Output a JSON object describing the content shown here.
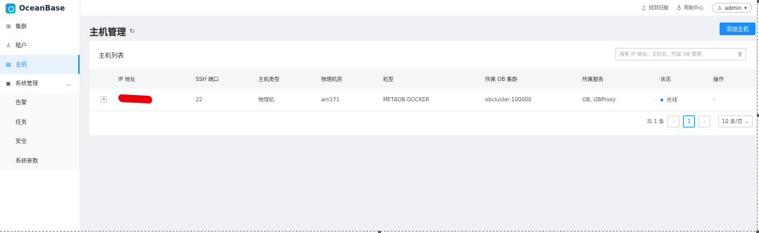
{
  "brand": {
    "name": "OceanBase"
  },
  "sidebar": {
    "items": [
      {
        "label": "集群",
        "icon": "grid-icon"
      },
      {
        "label": "租户",
        "icon": "tenant-icon"
      },
      {
        "label": "主机",
        "icon": "host-icon",
        "active": true
      },
      {
        "label": "系统管理",
        "icon": "system-icon",
        "expanded": true
      }
    ],
    "sub_items": [
      {
        "label": "告警"
      },
      {
        "label": "任务"
      },
      {
        "label": "安全"
      },
      {
        "label": "系统参数"
      }
    ]
  },
  "topbar": {
    "back_old": "回到旧版",
    "help": "帮助中心",
    "user": "admin"
  },
  "page": {
    "title": "主机管理",
    "add_button": "添加主机"
  },
  "card": {
    "title": "主机列表",
    "search_placeholder": "搜索 IP 地址、主机名、所属 OB 集群"
  },
  "table": {
    "columns": [
      "IP 地址",
      "SSH 端口",
      "主机类型",
      "物理机房",
      "机型",
      "所属 OB 集群",
      "所属服务",
      "状态",
      "操作"
    ],
    "rows": [
      {
        "ssh_port": "22",
        "host_type": "物理机",
        "idc": "am171",
        "model": "METAOB-DOCKER",
        "cluster": "obcluster:100000",
        "services": "OB, OBProxy",
        "status": "在线",
        "action": "-"
      }
    ]
  },
  "pagination": {
    "total": "共 1 条",
    "current": "1",
    "page_size": "10 条/页"
  },
  "colors": {
    "accent": "#1d8cf8",
    "redaction": "#e8000b"
  }
}
